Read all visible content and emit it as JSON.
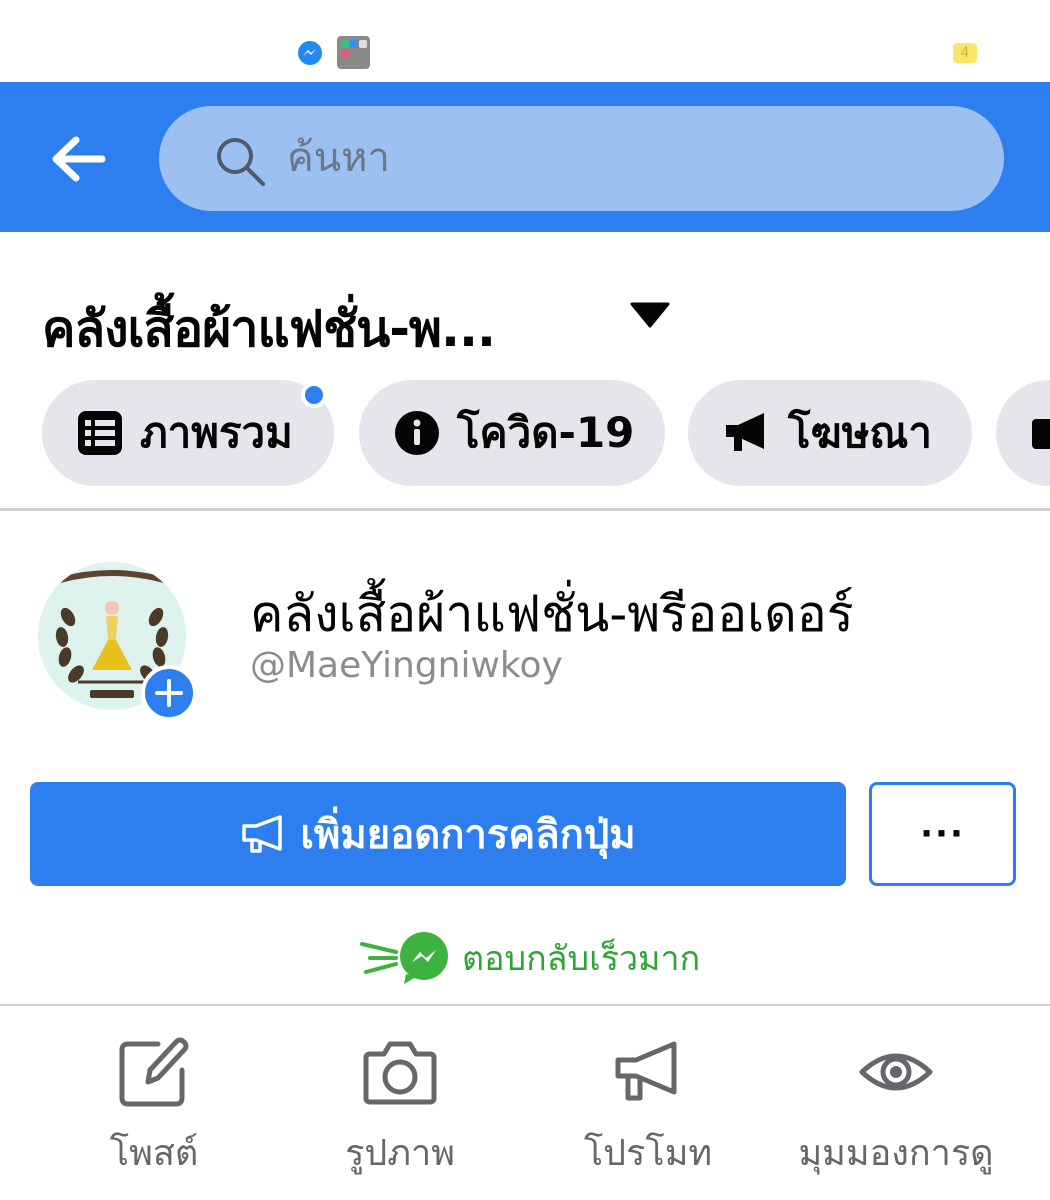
{
  "status_bar": {
    "badge_text": "4"
  },
  "header": {
    "search": {
      "placeholder": "ค้นหา"
    },
    "icons": [
      "back-arrow-icon",
      "search-icon"
    ],
    "color": "#2d7ff0"
  },
  "page": {
    "title_short": "คลังเสื้อผ้าแฟชั่น-พ...",
    "name": "คลังเสื้อผ้าแฟชั่น-พรีออเดอร์",
    "handle": "@MaeYingniwkoy"
  },
  "tabs": [
    {
      "label": "ภาพรวม",
      "icon": "list-icon",
      "has_dot": true
    },
    {
      "label": "โควิด-19",
      "icon": "info-icon",
      "has_dot": false
    },
    {
      "label": "โฆษณา",
      "icon": "megaphone-icon",
      "has_dot": false
    }
  ],
  "buttons": {
    "boost_label": "เพิ่มยอดการคลิกปุ่ม",
    "more_label": "···"
  },
  "response": {
    "label": "ตอบกลับเร็วมาก",
    "color": "#2fa533"
  },
  "actions": [
    {
      "label": "โพสต์",
      "icon": "edit-icon"
    },
    {
      "label": "รูปภาพ",
      "icon": "camera-icon"
    },
    {
      "label": "โปรโมท",
      "icon": "megaphone-icon"
    },
    {
      "label": "มุมมองการดู",
      "icon": "eye-icon"
    }
  ]
}
